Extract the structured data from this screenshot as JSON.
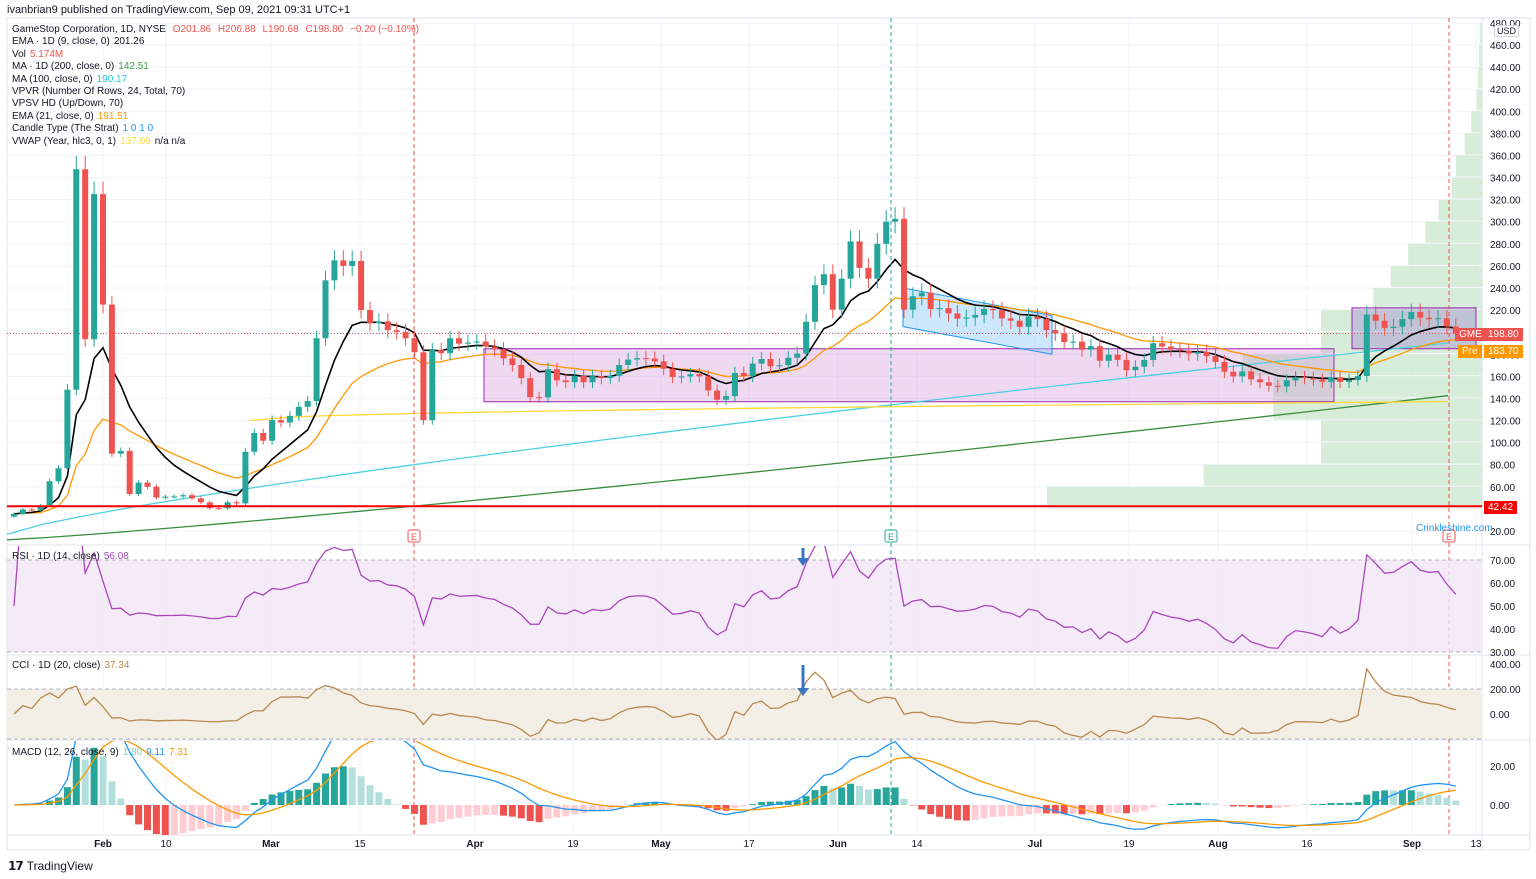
{
  "header": {
    "published": "ivanbrian9 published on TradingView.com, Sep 09, 2021 09:31 UTC+1"
  },
  "legend": {
    "symbol": "GameStop Corporation, 1D, NYSE",
    "o": "O201.86",
    "h": "H206.88",
    "l": "L190.68",
    "c": "C198.80",
    "chg": "−0.20 (−0.10%)",
    "ema9_label": "EMA · 1D (9, close, 0)",
    "ema9_val": "201.26",
    "vol_label": "Vol",
    "vol_val": "5.174M",
    "ma200_label": "MA · 1D (200, close, 0)",
    "ma200_val": "142.51",
    "ma100_label": "MA (100, close, 0)",
    "ma100_val": "190.17",
    "vpvr_label": "VPVR (Number Of Rows, 24, Total, 70)",
    "vpsv_label": "VPSV HD (Up/Down, 70)",
    "ema21_label": "EMA (21, close, 0)",
    "ema21_val": "191.51",
    "strat_label": "Candle Type (The Strat)",
    "strat_val": "1 0 1 0",
    "vwap_label": "VWAP (Year, hlc3, 0, 1)",
    "vwap_val": "137.09",
    "vwap_na": "n/a  n/a"
  },
  "rsi": {
    "label": "RSI · 1D (14, close)",
    "value": "56.08",
    "ticks": [
      "70.00",
      "60.00",
      "50.00",
      "40.00",
      "30.00"
    ]
  },
  "cci": {
    "label": "CCI · 1D (20, close)",
    "value": "37.34",
    "ticks": [
      "400.00",
      "200.00",
      "0.00"
    ]
  },
  "macd": {
    "label": "MACD (12, 26, close, 9)",
    "hist": "1.80",
    "macd": "9.11",
    "signal": "7.31",
    "ticks": [
      "20.00",
      "0.00"
    ]
  },
  "axis": {
    "currency": "USD",
    "price_ticks": [
      "480.00",
      "460.00",
      "440.00",
      "420.00",
      "400.00",
      "380.00",
      "360.00",
      "340.00",
      "320.00",
      "300.00",
      "280.00",
      "260.00",
      "240.00",
      "220.00",
      "200.00",
      "180.00",
      "160.00",
      "140.00",
      "120.00",
      "100.00",
      "80.00",
      "60.00",
      "40.00",
      "20.00"
    ],
    "time_ticks": [
      "Feb",
      "10",
      "Mar",
      "15",
      "Apr",
      "19",
      "May",
      "17",
      "Jun",
      "14",
      "Jul",
      "19",
      "Aug",
      "16",
      "Sep",
      "13"
    ]
  },
  "tags": {
    "gme_label": "GME",
    "gme_price": "198.80",
    "pre_label": "Pre",
    "pre_price": "183.70",
    "support": "42.42",
    "earnings": "E"
  },
  "watermark": "Crinkleshine.com",
  "footer": {
    "brand": "TradingView",
    "logo": "17"
  },
  "colors": {
    "up": "#26a69a",
    "down": "#ef5350",
    "ema9": "#000000",
    "ema21": "#ff9800",
    "ma100": "#4dd0e1",
    "ma200": "#388e3c",
    "vwap": "#fdd835",
    "rsi": "#ab47bc",
    "cci": "#b8884e",
    "macd": "#2196f3",
    "signal": "#ff9800"
  },
  "chart_data": {
    "type": "candlestick",
    "title": "GameStop Corporation, 1D, NYSE",
    "start_date": "2021-01-15",
    "closes": [
      35.5,
      39.4,
      39.1,
      43.0,
      65.0,
      76.8,
      147.9,
      347.5,
      193.6,
      325.0,
      225.0,
      90.0,
      92.4,
      53.5,
      63.8,
      60.0,
      50.3,
      51.1,
      51.3,
      52.4,
      49.5,
      45.9,
      40.7,
      40.6,
      46.0,
      45.0,
      91.7,
      108.7,
      101.7,
      120.4,
      118.2,
      124.2,
      132.4,
      137.7,
      194.5,
      246.9,
      265.0,
      260.0,
      264.5,
      220.0,
      208.2,
      209.8,
      201.8,
      200.3,
      194.5,
      181.8,
      120.3,
      183.8,
      181.0,
      194.5,
      189.6,
      190.7,
      191.5,
      187.0,
      184.5,
      176.2,
      170.3,
      158.4,
      141.1,
      141.0,
      166.5,
      156.4,
      154.7,
      160.4,
      154.7,
      160.2,
      158.4,
      160.5,
      170.3,
      175.2,
      176.5,
      176.2,
      173.6,
      166.9,
      159.3,
      159.9,
      162.0,
      160.0,
      147.2,
      138.8,
      142.1,
      163.1,
      160.2,
      171.5,
      175.7,
      169.1,
      170.1,
      176.8,
      180.6,
      209.4,
      242.6,
      252.5,
      220.4,
      248.4,
      282.2,
      258.2,
      248.4,
      280.0,
      300.0,
      302.6,
      220.4,
      232.5,
      235.8,
      221.0,
      221.8,
      217.0,
      212.2,
      213.3,
      215.6,
      221.1,
      219.9,
      212.5,
      210.4,
      204.8,
      214.1,
      211.9,
      201.9,
      199.0,
      191.0,
      191.4,
      184.2,
      187.3,
      174.1,
      179.6,
      174.9,
      165.6,
      168.7,
      174.8,
      190.0,
      187.0,
      184.4,
      183.2,
      180.6,
      182.0,
      178.4,
      173.1,
      164.2,
      160.0,
      164.5,
      157.3,
      154.6,
      151.5,
      150.8,
      156.4,
      159.3,
      158.4,
      157.0,
      155.0,
      159.2,
      154.9,
      156.7,
      160.3,
      216.0,
      210.3,
      203.8,
      204.9,
      211.8,
      218.2,
      213.1,
      211.7,
      212.6,
      205.2,
      198.8
    ],
    "ma100_endpoints": [
      17,
      190.17
    ],
    "ma200_endpoints": [
      12,
      142.51
    ],
    "vwap_range": [
      120,
      137.09
    ],
    "support_level": 42.42,
    "volume_profile": {
      "row_start": 40,
      "row_size": 20,
      "relative_volume": [
        1.0,
        0.64,
        0.37,
        0.37,
        0.48,
        0.48,
        0.55,
        0.37,
        0.37,
        0.25,
        0.21,
        0.17,
        0.13,
        0.1,
        0.07,
        0.06,
        0.04,
        0.025,
        0.012,
        0.009,
        0.007,
        0.005
      ]
    },
    "ylim": [
      20,
      480
    ],
    "y_axis": "USD"
  }
}
